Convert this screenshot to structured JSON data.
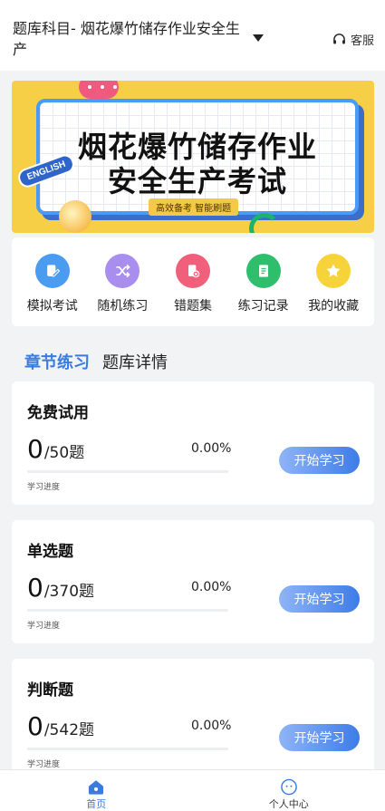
{
  "header": {
    "title": "题库科目- 烟花爆竹储存作业安全生产",
    "service_label": "客服"
  },
  "banner": {
    "line1": "烟花爆竹储存作业",
    "line2": "安全生产考试",
    "tag": "高效备考  智能刷题",
    "english": "ENGLISH"
  },
  "quick_menu": [
    {
      "label": "模拟考试",
      "icon": "edit-icon",
      "color": "#4a9cf0"
    },
    {
      "label": "随机练习",
      "icon": "shuffle-icon",
      "color": "#a98ef0"
    },
    {
      "label": "错题集",
      "icon": "error-book-icon",
      "color": "#f0607a"
    },
    {
      "label": "练习记录",
      "icon": "notebook-icon",
      "color": "#2fbf6c"
    },
    {
      "label": "我的收藏",
      "icon": "star-icon",
      "color": "#f7d33a"
    }
  ],
  "tabs": {
    "chapter": "章节练习",
    "detail": "题库详情"
  },
  "cards": [
    {
      "title": "免费试用",
      "done": "0",
      "total": "/50题",
      "percent": "0.00%",
      "progress": 0,
      "sub": "学习进度",
      "button": "开始学习"
    },
    {
      "title": "单选题",
      "done": "0",
      "total": "/370题",
      "percent": "0.00%",
      "progress": 0,
      "sub": "学习进度",
      "button": "开始学习"
    },
    {
      "title": "判断题",
      "done": "0",
      "total": "/542题",
      "percent": "0.00%",
      "progress": 0,
      "sub": "学习进度",
      "button": "开始学习"
    }
  ],
  "bottom_nav": {
    "home": "首页",
    "me": "个人中心"
  },
  "colors": {
    "accent": "#3a7be0",
    "banner_bg": "#f7cf47"
  }
}
